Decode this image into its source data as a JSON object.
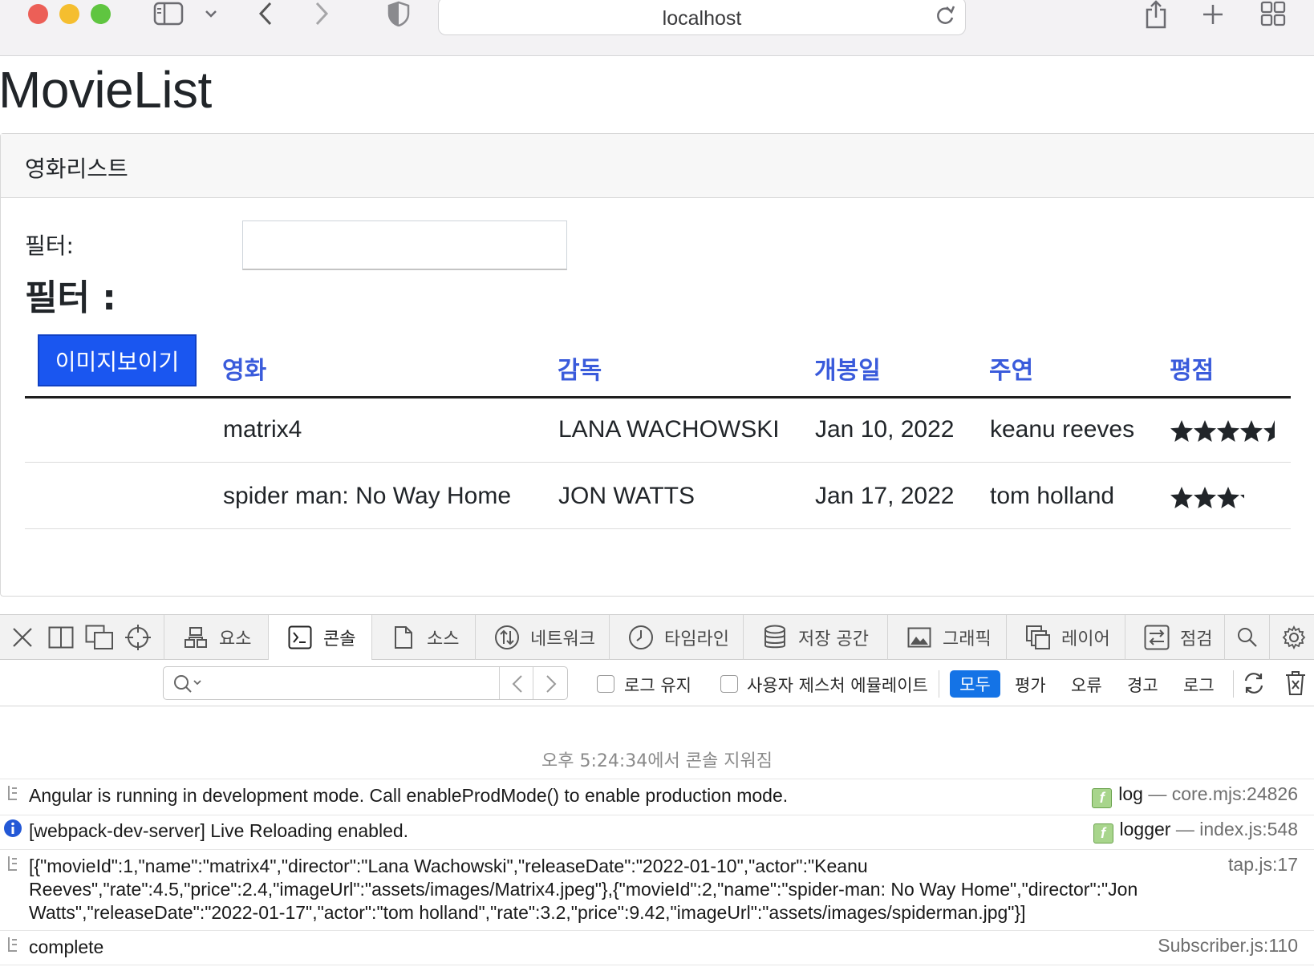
{
  "browser": {
    "url": "localhost",
    "traffic_lights": {
      "close": "#ec5f57",
      "minimize": "#f5be2f",
      "zoom": "#5fc540"
    },
    "icons": [
      "sidebar-icon",
      "chevron-down-icon",
      "back-icon",
      "forward-icon",
      "shield-icon",
      "reload-icon",
      "share-icon",
      "new-tab-icon",
      "tab-overview-icon"
    ]
  },
  "app": {
    "title": "MovieList",
    "card_header": "영화리스트",
    "filter_label": "필터:",
    "filter_value": "",
    "filter_heading": "필터 :",
    "show_images_button": "이미지보이기",
    "columns": [
      "영화",
      "감독",
      "개봉일",
      "주연",
      "평점"
    ],
    "movies": [
      {
        "name": "matrix4",
        "director": "LANA WACHOWSKI",
        "release": "Jan 10, 2022",
        "actor": "keanu reeves",
        "rating": 4.5
      },
      {
        "name": "spider man: No Way Home",
        "director": "JON WATTS",
        "release": "Jan 17, 2022",
        "actor": "tom holland",
        "rating": 3.2
      }
    ],
    "header_color": "#3a5bdb",
    "button_color": "#1a56f0"
  },
  "devtools": {
    "tabs": [
      "요소",
      "콘솔",
      "소스",
      "네트워크",
      "타임라인",
      "저장 공간",
      "그래픽",
      "레이어",
      "점검"
    ],
    "active_tab": "콘솔",
    "search_value": "",
    "preserve_log": "로그 유지",
    "emulate_gesture": "사용자 제스처 에뮬레이트",
    "levels": [
      "모두",
      "평가",
      "오류",
      "경고",
      "로그"
    ],
    "active_level": "모두",
    "cleared_message": "오후 5:24:34에서 콘솔 지워짐",
    "messages": [
      {
        "text": "Angular is running in development mode. Call enableProdMode() to enable production mode.",
        "kind": "log",
        "source": "core.mjs:24826",
        "level": "log"
      },
      {
        "text": "[webpack-dev-server] Live Reloading enabled.",
        "kind": "logger",
        "source": "index.js:548",
        "level": "info"
      },
      {
        "line1": "[{\"movieId\":1,\"name\":\"matrix4\",\"director\":\"Lana Wachowski\",\"releaseDate\":\"2022-01-10\",\"actor\":\"Keanu",
        "line2": "Reeves\",\"rate\":4.5,\"price\":2.4,\"imageUrl\":\"assets/images/Matrix4.jpeg\"},{\"movieId\":2,\"name\":\"spider-man: No Way Home\",\"director\":\"Jon",
        "line3": "Watts\",\"releaseDate\":\"2022-01-17\",\"actor\":\"tom holland\",\"rate\":3.2,\"price\":9.42,\"imageUrl\":\"assets/images/spiderman.jpg\"}]",
        "source": "tap.js:17",
        "level": "log"
      },
      {
        "text": "complete",
        "source": "Subscriber.js:110",
        "level": "log"
      }
    ]
  }
}
